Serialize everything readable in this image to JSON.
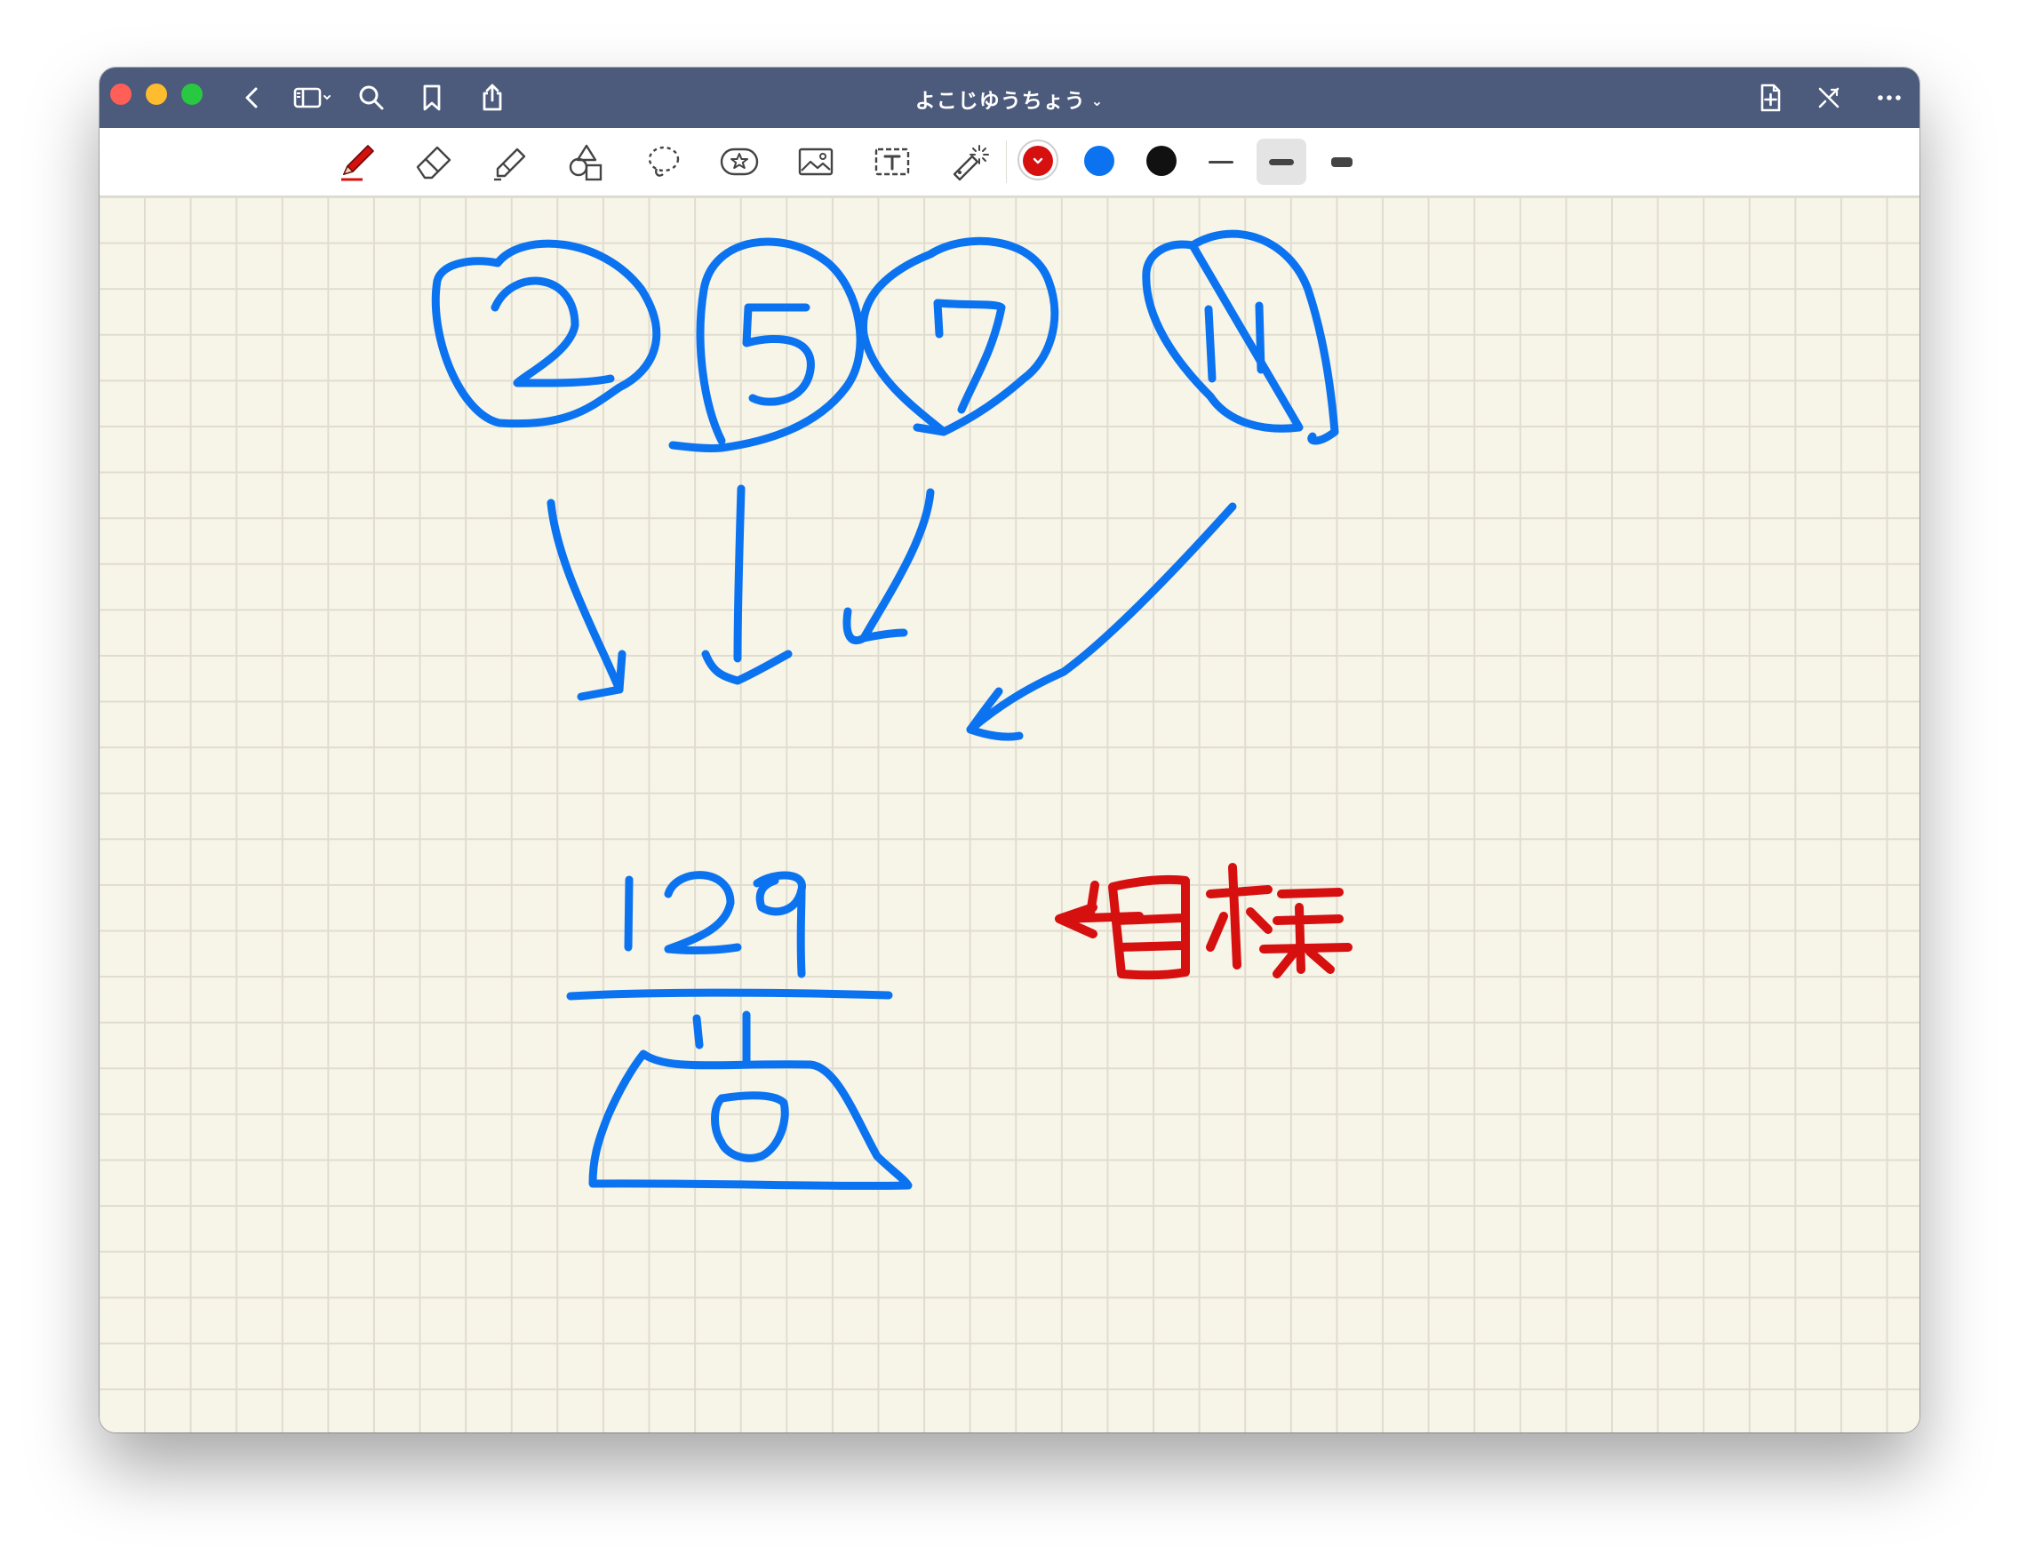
{
  "window": {
    "title": "よこじゆうちょう",
    "title_chevron": "⌄"
  },
  "titlebar": {
    "left_icons": [
      "back-chevron-icon",
      "sidebar-toggle-icon",
      "search-icon",
      "bookmark-icon",
      "share-icon"
    ],
    "right_icons": [
      "add-page-icon",
      "close-pen-icon",
      "more-icon"
    ]
  },
  "toolbar": {
    "tools": [
      "pen-icon",
      "eraser-icon",
      "highlighter-icon",
      "shapes-icon",
      "lasso-icon",
      "sticker-icon",
      "image-icon",
      "text-box-icon",
      "laser-pointer-icon"
    ],
    "colors": [
      {
        "name": "red",
        "hex": "#d60f0f",
        "selected": true
      },
      {
        "name": "blue",
        "hex": "#0b73f0",
        "selected": false
      },
      {
        "name": "black",
        "hex": "#111111",
        "selected": false
      }
    ],
    "thickness_options": [
      "thin",
      "medium",
      "thick"
    ],
    "selected_thickness": "medium"
  },
  "colors": {
    "titlebar": "#4c5a7c",
    "paper": "#f7f4e8",
    "grid": "#e0ddd0",
    "ink_blue": "#0b73f0",
    "ink_red": "#d60f0f"
  },
  "handwriting": {
    "circled_numbers": [
      "2",
      "5",
      "7",
      "11"
    ],
    "target_number": "129",
    "target_label": "←目標"
  }
}
